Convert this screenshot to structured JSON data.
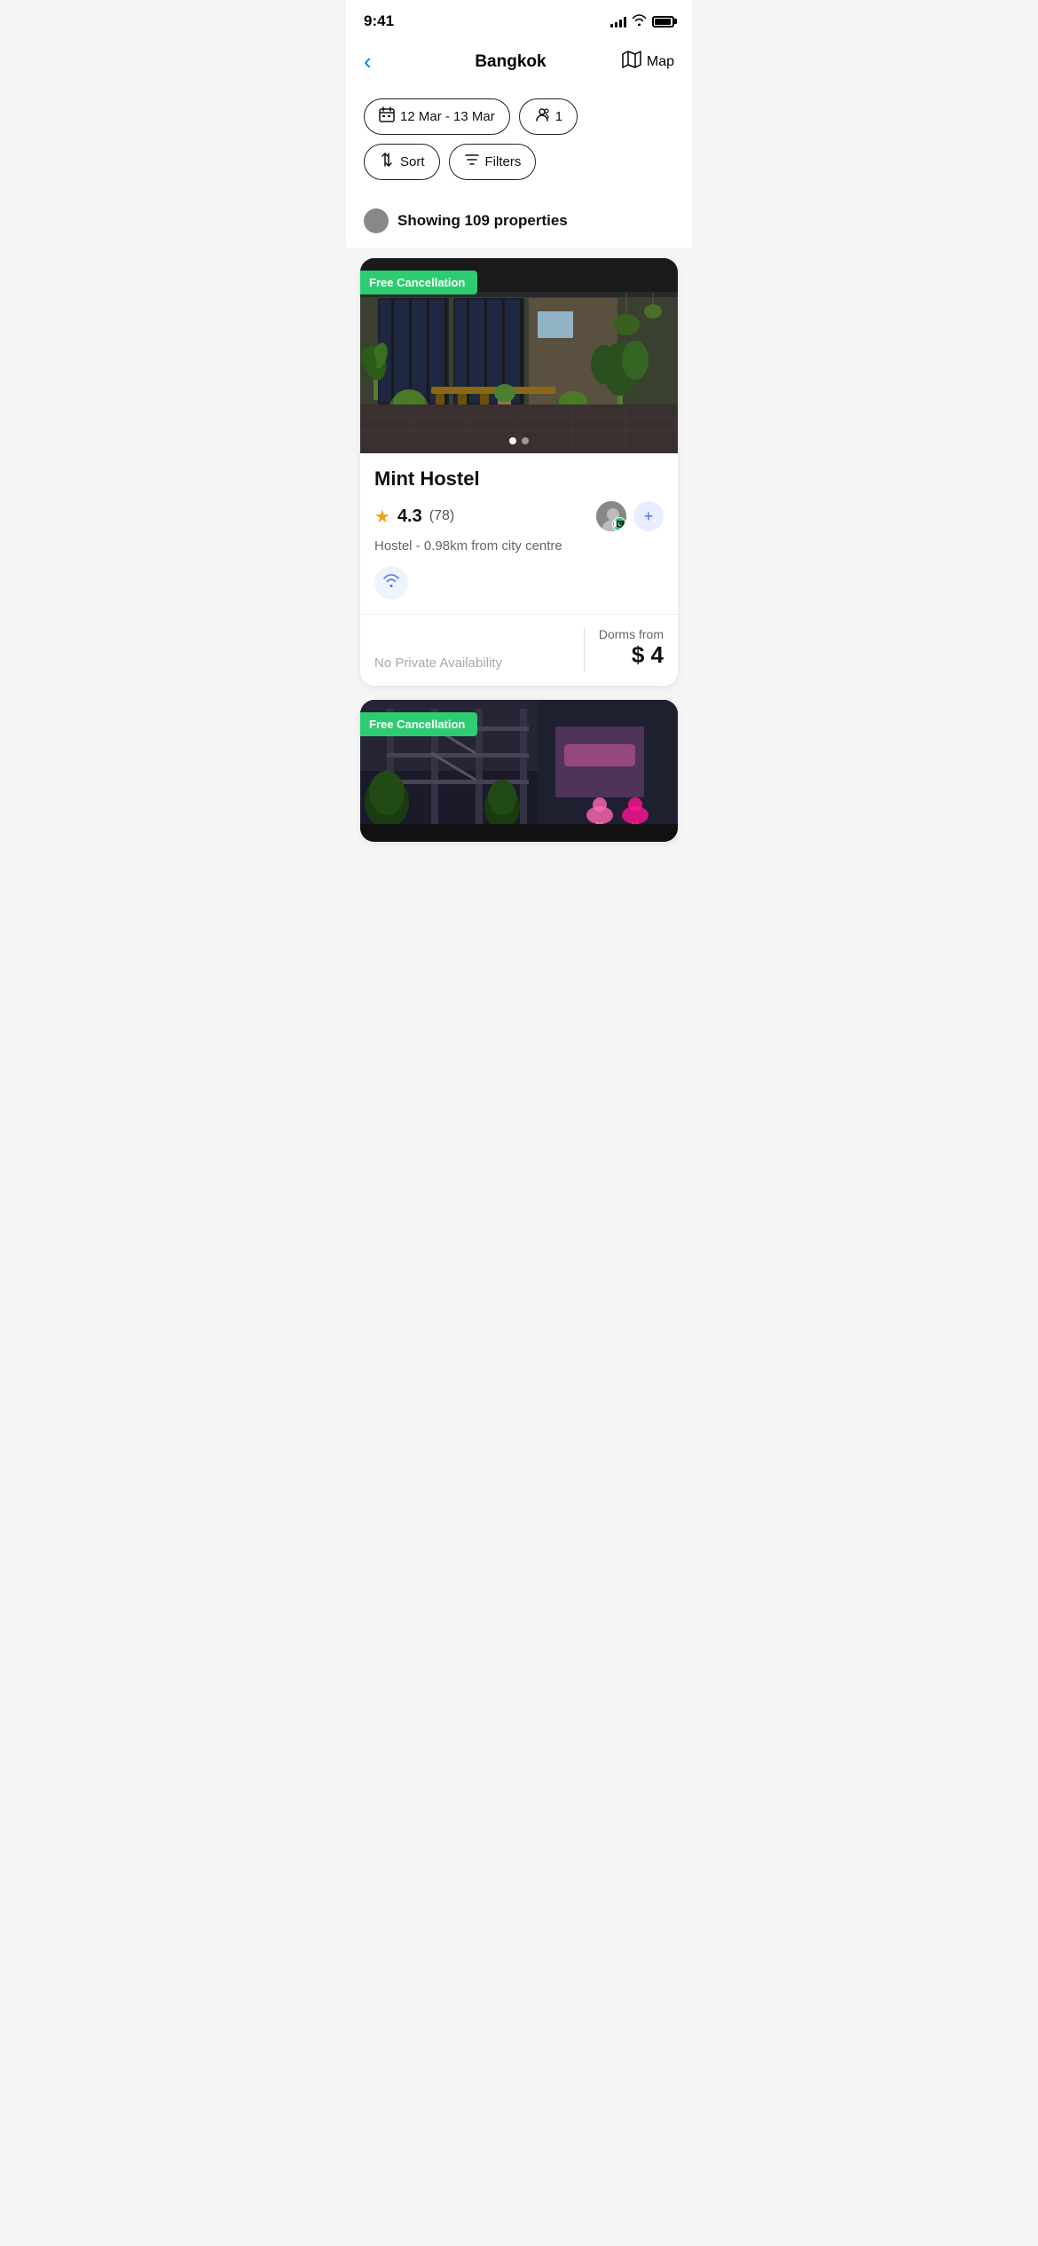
{
  "status_bar": {
    "time": "9:41",
    "signal_bars": [
      4,
      6,
      9,
      12,
      14
    ],
    "wifi": "wifi",
    "battery_level": 88
  },
  "header": {
    "back_label": "‹",
    "title": "Bangkok",
    "map_label": "Map",
    "map_icon": "🗺"
  },
  "filters": {
    "date_label": "12 Mar - 13 Mar",
    "date_icon": "📅",
    "guests_label": "1",
    "guests_icon": "👤",
    "sort_label": "Sort",
    "sort_icon": "↕",
    "filters_label": "Filters",
    "filters_icon": "≡"
  },
  "results": {
    "text": "Showing 109 properties",
    "count": 109
  },
  "properties": [
    {
      "id": 1,
      "name": "Mint Hostel",
      "free_cancellation": true,
      "free_cancellation_label": "Free Cancellation",
      "rating": "4.3",
      "review_count": "(78)",
      "type": "Hostel",
      "distance": "0.98km from city centre",
      "no_private_label": "No Private Availability",
      "dorms_from_label": "Dorms from",
      "price": "$ 4",
      "amenities": [
        "wifi"
      ],
      "image_dots": 2,
      "active_dot": 0
    },
    {
      "id": 2,
      "free_cancellation": true,
      "free_cancellation_label": "Free Cancellation"
    }
  ]
}
